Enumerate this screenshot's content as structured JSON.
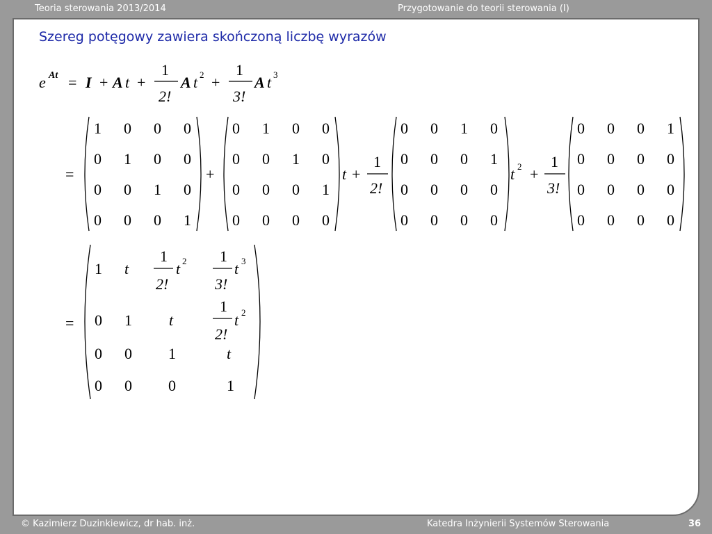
{
  "header": {
    "course": "Teoria sterowania 2013/2014",
    "section": "Przygotowanie do teorii sterowania (I)"
  },
  "slide": {
    "title": "Szereg potęgowy zawiera skończoną liczbę wyrazów"
  },
  "equation": {
    "lhs_base": "e",
    "lhs_exp": "At",
    "eq": "=",
    "plus": "+",
    "I": "I",
    "A": "A",
    "t": "t",
    "one": "1",
    "fact2": "2!",
    "fact3": "3!",
    "sq": "2",
    "cube": "3",
    "matrix_I": [
      [
        "1",
        "0",
        "0",
        "0"
      ],
      [
        "0",
        "1",
        "0",
        "0"
      ],
      [
        "0",
        "0",
        "1",
        "0"
      ],
      [
        "0",
        "0",
        "0",
        "1"
      ]
    ],
    "matrix_A": [
      [
        "0",
        "1",
        "0",
        "0"
      ],
      [
        "0",
        "0",
        "1",
        "0"
      ],
      [
        "0",
        "0",
        "0",
        "1"
      ],
      [
        "0",
        "0",
        "0",
        "0"
      ]
    ],
    "matrix_A2": [
      [
        "0",
        "0",
        "1",
        "0"
      ],
      [
        "0",
        "0",
        "0",
        "1"
      ],
      [
        "0",
        "0",
        "0",
        "0"
      ],
      [
        "0",
        "0",
        "0",
        "0"
      ]
    ],
    "matrix_A3": [
      [
        "0",
        "0",
        "0",
        "1"
      ],
      [
        "0",
        "0",
        "0",
        "0"
      ],
      [
        "0",
        "0",
        "0",
        "0"
      ],
      [
        "0",
        "0",
        "0",
        "0"
      ]
    ],
    "result_plain": [
      "1",
      "t",
      "0",
      "1",
      "t",
      "0",
      "0",
      "1",
      "t",
      "0",
      "0",
      "0",
      "1"
    ]
  },
  "footer": {
    "author": "© Kazimierz Duzinkiewicz, dr hab. inż.",
    "department": "Katedra Inżynierii Systemów Sterowania",
    "page_number": "36"
  }
}
